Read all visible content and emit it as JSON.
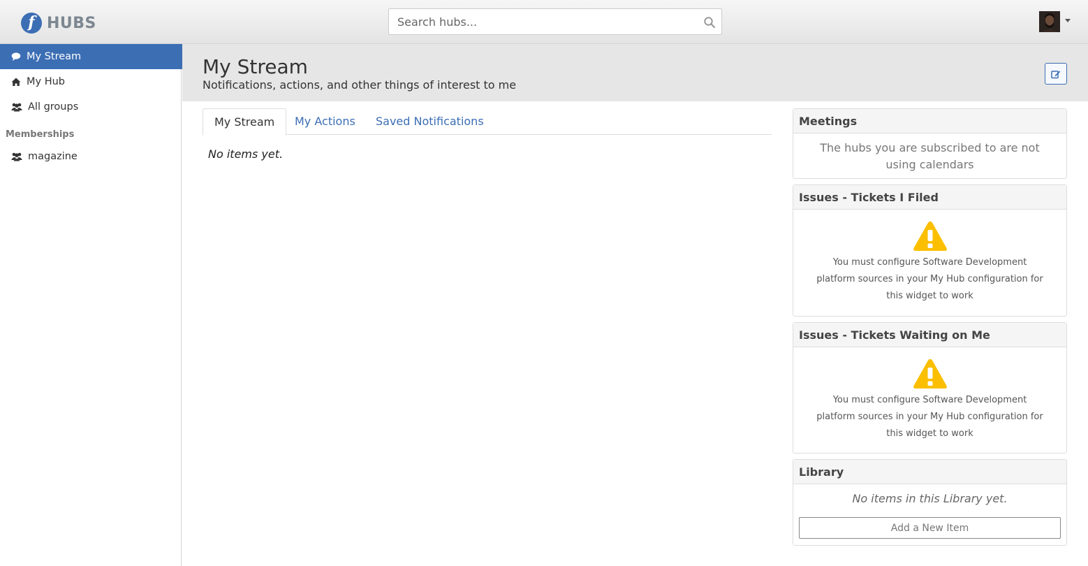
{
  "header": {
    "logo_text": "HUBS",
    "search_placeholder": "Search hubs...",
    "brand_color": "#3c6eb4"
  },
  "sidebar": {
    "items": [
      {
        "label": "My Stream",
        "icon": "speech-bubble-icon",
        "active": true
      },
      {
        "label": "My Hub",
        "icon": "home-icon",
        "active": false
      },
      {
        "label": "All groups",
        "icon": "users-icon",
        "active": false
      }
    ],
    "memberships_header": "Memberships",
    "memberships": [
      {
        "label": "magazine",
        "icon": "users-icon"
      }
    ]
  },
  "page": {
    "title": "My Stream",
    "subtitle": "Notifications, actions, and other things of interest to me"
  },
  "tabs": [
    {
      "label": "My Stream",
      "active": true
    },
    {
      "label": "My Actions",
      "active": false
    },
    {
      "label": "Saved Notifications",
      "active": false
    }
  ],
  "stream": {
    "empty_text": "No items yet."
  },
  "widgets": {
    "meetings": {
      "title": "Meetings",
      "message": "The hubs you are subscribed to are not using calendars"
    },
    "tickets_filed": {
      "title": "Issues - Tickets I Filed",
      "message": "You must configure Software Development platform sources in your My Hub configuration for this widget to work",
      "warning_color": "#fbbf00"
    },
    "tickets_waiting": {
      "title": "Issues - Tickets Waiting on Me",
      "message": "You must configure Software Development platform sources in your My Hub configuration for this widget to work",
      "warning_color": "#fbbf00"
    },
    "library": {
      "title": "Library",
      "empty_text": "No items in this Library yet.",
      "add_label": "Add a New Item"
    }
  }
}
